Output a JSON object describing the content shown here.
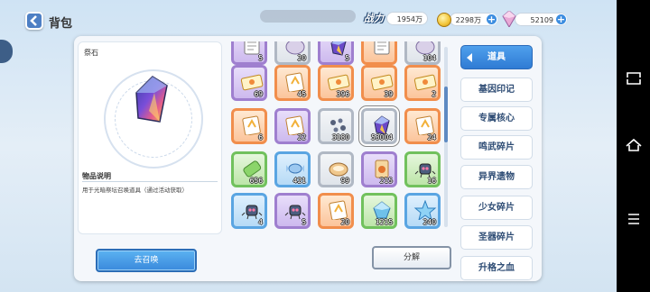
{
  "header": {
    "title": "背包"
  },
  "currency": {
    "power_label": "战力",
    "power_value": "1954万",
    "coins": "2298万",
    "gems": "52109"
  },
  "detail": {
    "item_name": "祭石",
    "desc_title": "物品说明",
    "desc_text": "用于光暗祭坛召唤道具（通过活动获取）"
  },
  "grid": {
    "rows": [
      [
        {
          "color": "purple",
          "icon": "paper-icon",
          "qty": "5"
        },
        {
          "color": "gray",
          "icon": "stone-icon",
          "qty": "20"
        },
        {
          "color": "purple",
          "icon": "crystal-icon",
          "qty": "5"
        },
        {
          "color": "orange",
          "icon": "paper-icon",
          "qty": ""
        },
        {
          "color": "gray",
          "icon": "stone-icon",
          "qty": "104"
        }
      ],
      [
        {
          "color": "purple",
          "icon": "ticket-icon",
          "qty": "69"
        },
        {
          "color": "orange",
          "icon": "card-icon",
          "qty": "45"
        },
        {
          "color": "orange",
          "icon": "ticket-icon",
          "qty": "396"
        },
        {
          "color": "orange",
          "icon": "ticket-icon",
          "qty": "39"
        },
        {
          "color": "orange",
          "icon": "ticket-icon",
          "qty": "2"
        }
      ],
      [
        {
          "color": "orange",
          "icon": "card-icon",
          "qty": "6"
        },
        {
          "color": "purple",
          "icon": "card-icon",
          "qty": "22"
        },
        {
          "color": "gray",
          "icon": "fragments-icon",
          "qty": "3180"
        },
        {
          "color": "gray",
          "icon": "crystal-icon",
          "qty": "53004"
        },
        {
          "color": "orange",
          "icon": "card-icon",
          "qty": "24"
        }
      ],
      [
        {
          "color": "green",
          "icon": "battery-icon",
          "qty": "656"
        },
        {
          "color": "blue",
          "icon": "candy-icon",
          "qty": "421"
        },
        {
          "color": "gray",
          "icon": "bread-icon",
          "qty": "99"
        },
        {
          "color": "purple",
          "icon": "pack-icon",
          "qty": "215"
        },
        {
          "color": "green",
          "icon": "robot-icon",
          "qty": "16"
        }
      ],
      [
        {
          "color": "blue",
          "icon": "robot-icon",
          "qty": "4"
        },
        {
          "color": "purple",
          "icon": "robot-icon",
          "qty": "5"
        },
        {
          "color": "orange",
          "icon": "card-icon",
          "qty": "20"
        },
        {
          "color": "green",
          "icon": "shard-icon",
          "qty": "1215"
        },
        {
          "color": "blue",
          "icon": "star-icon",
          "qty": "240"
        }
      ]
    ]
  },
  "tabs": [
    "道具",
    "基因印记",
    "专属核心",
    "鸣武碎片",
    "异界遗物",
    "少女碎片",
    "圣器碎片",
    "升格之血"
  ],
  "buttons": {
    "summon": "去召唤",
    "split": "分解"
  },
  "colors": {
    "accent": "#3a89dc",
    "purple": "#9f7fcf",
    "orange": "#f18e4c",
    "blue": "#5aa5e2",
    "green": "#71c15d"
  }
}
